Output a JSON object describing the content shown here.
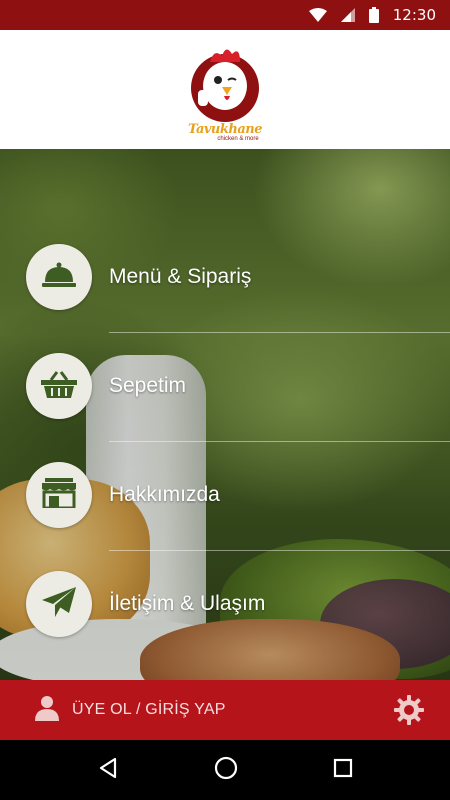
{
  "status_bar": {
    "time": "12:30",
    "icons": [
      "wifi-icon",
      "signal-icon",
      "battery-icon"
    ]
  },
  "header": {
    "logo_text": "Tavukhane",
    "logo_subtext": "chicken & more"
  },
  "menu": {
    "items": [
      {
        "label": "Menü & Sipariş",
        "icon": "food-dome-icon"
      },
      {
        "label": "Sepetim",
        "icon": "basket-icon"
      },
      {
        "label": "Hakkımızda",
        "icon": "store-icon"
      },
      {
        "label": "İletişim & Ulaşım",
        "icon": "paper-plane-icon"
      }
    ]
  },
  "bottom_bar": {
    "login_label": "ÜYE OL / GİRİŞ YAP",
    "user_icon": "user-icon",
    "settings_icon": "gear-icon"
  },
  "nav_bar": {
    "icons": [
      "back-icon",
      "home-icon",
      "recents-icon"
    ]
  },
  "colors": {
    "status_bar": "#8e1010",
    "brand_red": "#b5141b",
    "icon_green": "#3e5d22",
    "circle_bg": "#ecece4",
    "logo_gold": "#e8a11c"
  }
}
